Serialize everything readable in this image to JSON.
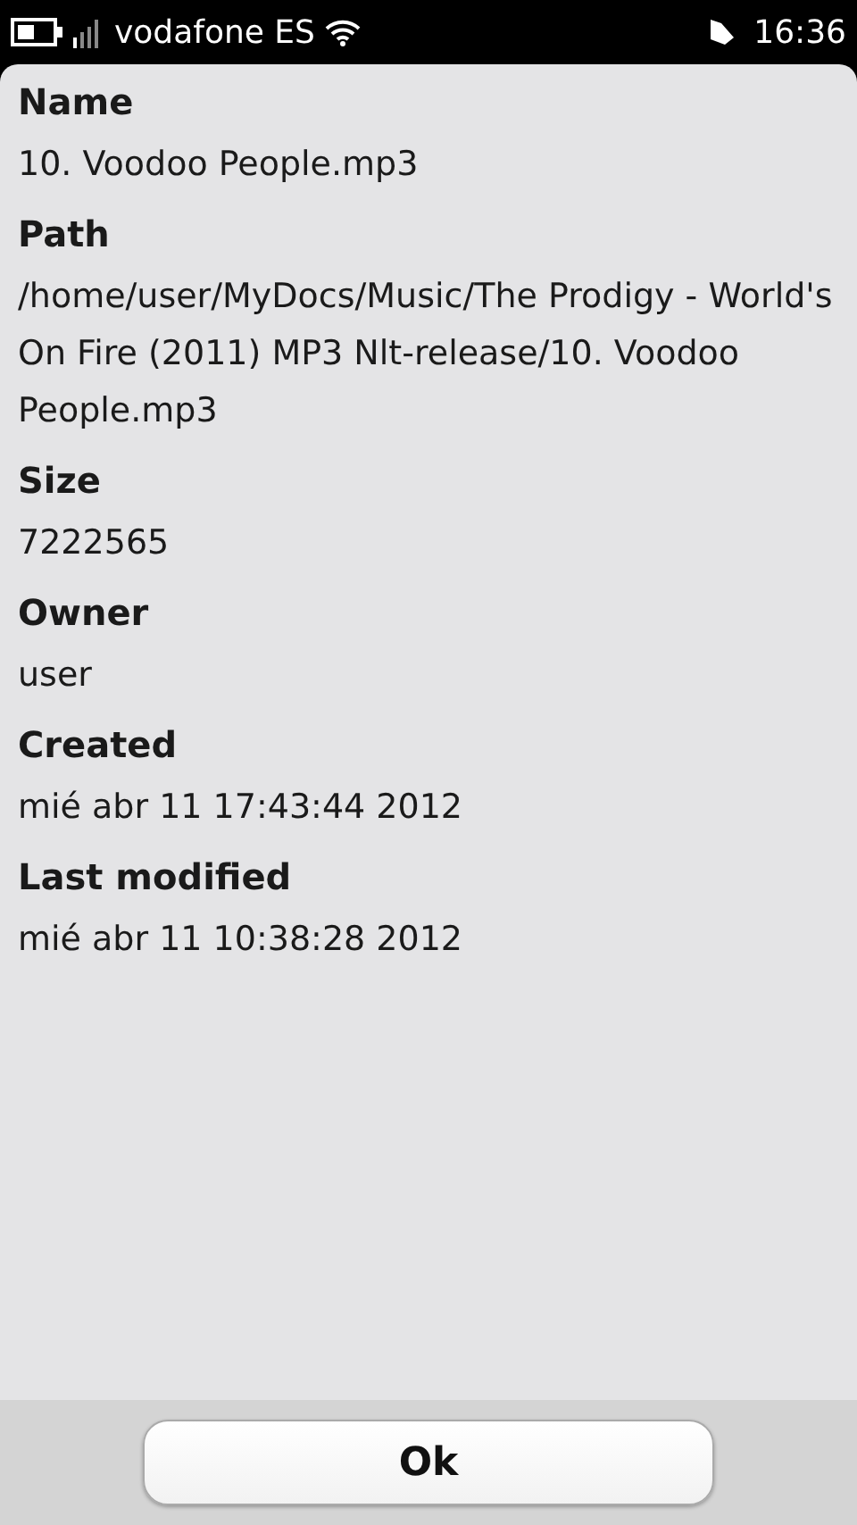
{
  "status_bar": {
    "carrier": "vodafone ES",
    "time": "16:36"
  },
  "fields": [
    {
      "label": "Name",
      "value": "10. Voodoo People.mp3"
    },
    {
      "label": "Path",
      "value": "/home/user/MyDocs/Music/The Prodigy - World's On Fire (2011) MP3 Nlt-release/10. Voodoo People.mp3"
    },
    {
      "label": "Size",
      "value": "7222565"
    },
    {
      "label": "Owner",
      "value": "user"
    },
    {
      "label": "Created",
      "value": "mié abr 11 17:43:44 2012"
    },
    {
      "label": "Last modified",
      "value": "mié abr 11 10:38:28 2012"
    }
  ],
  "buttons": [
    "Ok"
  ]
}
